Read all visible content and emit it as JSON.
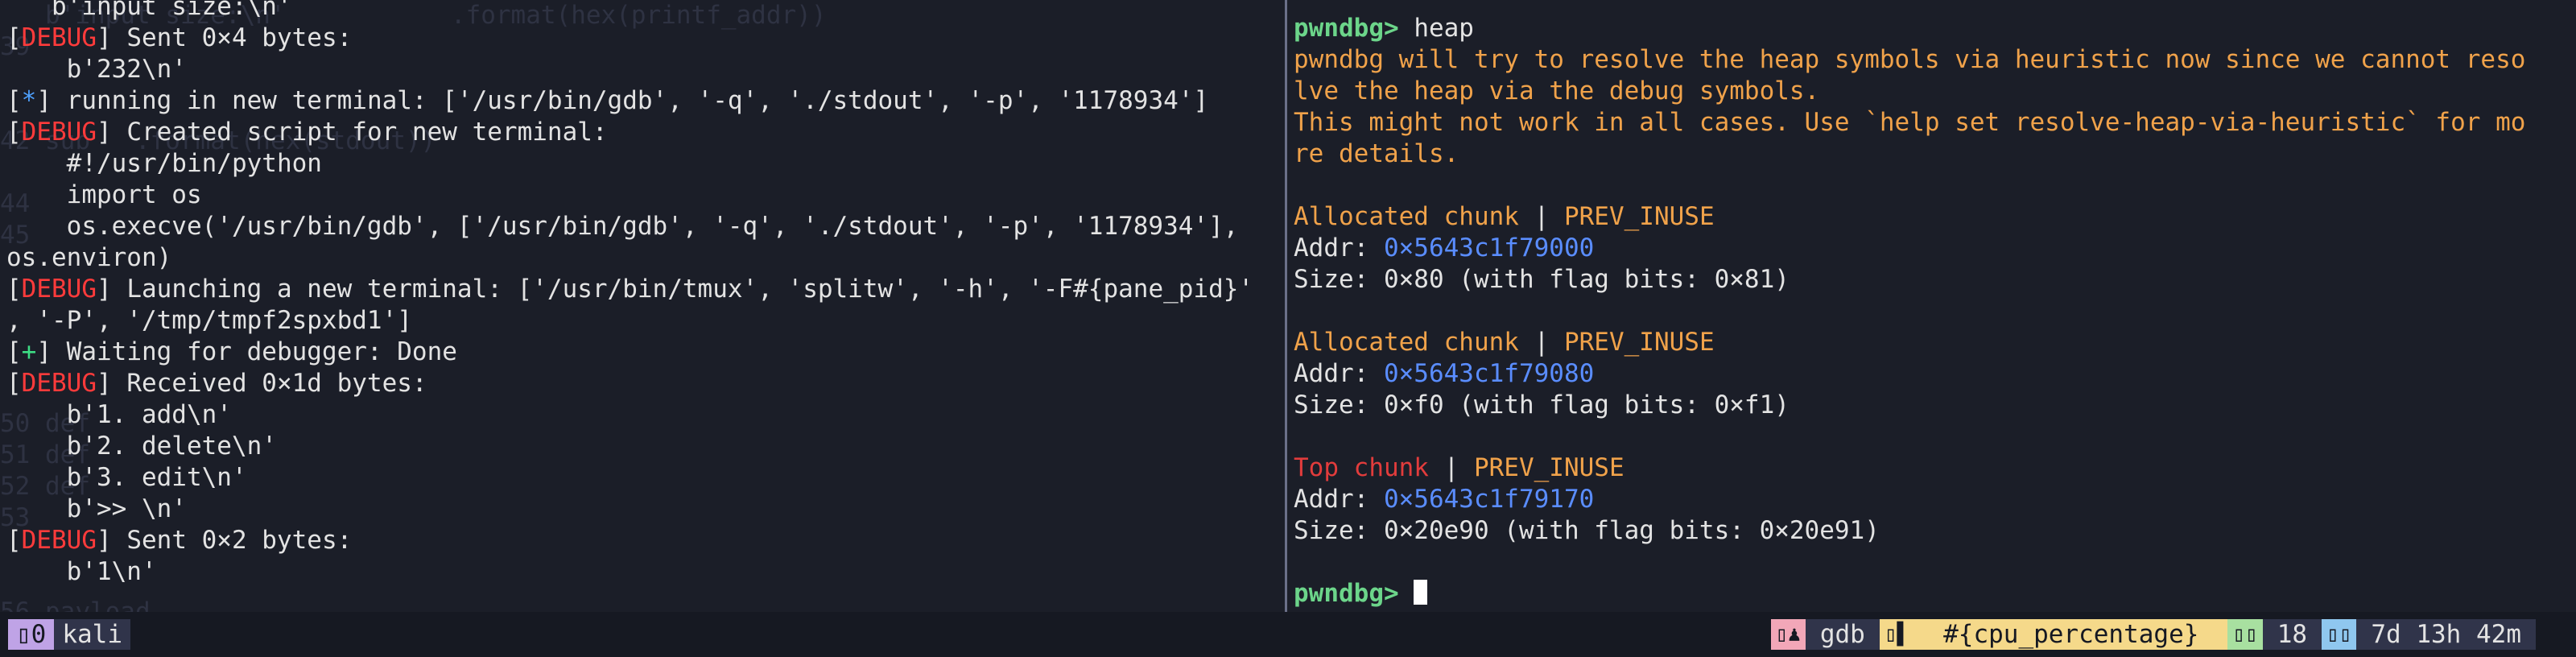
{
  "background_code": [
    "   b'input size:\\n'           .format(hex(printf_addr))",
    "39",
    "",
    "",
    "42 sub   .format(hex(stdout))",
    "",
    "44",
    "45",
    "",
    "",
    "",
    "",
    "",
    "50 def",
    "51 def",
    "52 def",
    "53",
    "",
    "",
    "56 payload"
  ],
  "left_pane": {
    "lines": [
      {
        "parts": [
          {
            "t": "   b'input size:\\n'",
            "c": "brk"
          }
        ]
      },
      {
        "parts": [
          {
            "t": "[",
            "c": "brk"
          },
          {
            "t": "DEBUG",
            "c": "dbg"
          },
          {
            "t": "] Sent 0×4 bytes:",
            "c": "brk"
          }
        ]
      },
      {
        "parts": [
          {
            "t": "    b'232\\n'",
            "c": "brk"
          }
        ]
      },
      {
        "parts": [
          {
            "t": "[",
            "c": "brk"
          },
          {
            "t": "*",
            "c": "star"
          },
          {
            "t": "] running in new terminal: ['/usr/bin/gdb', '-q', './stdout', '-p', '1178934']",
            "c": "brk"
          }
        ]
      },
      {
        "parts": [
          {
            "t": "[",
            "c": "brk"
          },
          {
            "t": "DEBUG",
            "c": "dbg"
          },
          {
            "t": "] Created script for new terminal:",
            "c": "brk"
          }
        ]
      },
      {
        "parts": [
          {
            "t": "    #!/usr/bin/python",
            "c": "brk"
          }
        ]
      },
      {
        "parts": [
          {
            "t": "    import os",
            "c": "brk"
          }
        ]
      },
      {
        "parts": [
          {
            "t": "    os.execve('/usr/bin/gdb', ['/usr/bin/gdb', '-q', './stdout', '-p', '1178934'],",
            "c": "brk"
          }
        ]
      },
      {
        "parts": [
          {
            "t": "os.environ)",
            "c": "brk"
          }
        ]
      },
      {
        "parts": [
          {
            "t": "[",
            "c": "brk"
          },
          {
            "t": "DEBUG",
            "c": "dbg"
          },
          {
            "t": "] Launching a new terminal: ['/usr/bin/tmux', 'splitw', '-h', '-F#{pane_pid}'",
            "c": "brk"
          }
        ]
      },
      {
        "parts": [
          {
            "t": ", '-P', '/tmp/tmpf2spxbd1']",
            "c": "brk"
          }
        ]
      },
      {
        "parts": [
          {
            "t": "[",
            "c": "brk"
          },
          {
            "t": "+",
            "c": "plus"
          },
          {
            "t": "] Waiting for debugger: Done",
            "c": "brk"
          }
        ]
      },
      {
        "parts": [
          {
            "t": "[",
            "c": "brk"
          },
          {
            "t": "DEBUG",
            "c": "dbg"
          },
          {
            "t": "] Received 0×1d bytes:",
            "c": "brk"
          }
        ]
      },
      {
        "parts": [
          {
            "t": "    b'1. add\\n'",
            "c": "brk"
          }
        ]
      },
      {
        "parts": [
          {
            "t": "    b'2. delete\\n'",
            "c": "brk"
          }
        ]
      },
      {
        "parts": [
          {
            "t": "    b'3. edit\\n'",
            "c": "brk"
          }
        ]
      },
      {
        "parts": [
          {
            "t": "    b'>> \\n'",
            "c": "brk"
          }
        ]
      },
      {
        "parts": [
          {
            "t": "[",
            "c": "brk"
          },
          {
            "t": "DEBUG",
            "c": "dbg"
          },
          {
            "t": "] Sent 0×2 bytes:",
            "c": "brk"
          }
        ]
      },
      {
        "parts": [
          {
            "t": "    b'1\\n'",
            "c": "brk"
          }
        ]
      }
    ]
  },
  "right_pane": {
    "lines": [
      {
        "parts": [
          {
            "t": "pwndbg>",
            "c": "prompt"
          },
          {
            "t": " heap",
            "c": "brk"
          }
        ]
      },
      {
        "parts": [
          {
            "t": "pwndbg will try to resolve the heap symbols via heuristic now since we cannot reso",
            "c": "warn"
          }
        ]
      },
      {
        "parts": [
          {
            "t": "lve the heap via the debug symbols.",
            "c": "warn"
          }
        ]
      },
      {
        "parts": [
          {
            "t": "This might not work in all cases. Use `help set resolve-heap-via-heuristic` for mo",
            "c": "warn"
          }
        ]
      },
      {
        "parts": [
          {
            "t": "re details.",
            "c": "warn"
          }
        ]
      },
      {
        "parts": [
          {
            "t": "",
            "c": "brk"
          }
        ]
      },
      {
        "parts": [
          {
            "t": "Allocated chunk",
            "c": "warn"
          },
          {
            "t": " | ",
            "c": "brk"
          },
          {
            "t": "PREV_INUSE",
            "c": "warn"
          }
        ]
      },
      {
        "parts": [
          {
            "t": "Addr: ",
            "c": "brk"
          },
          {
            "t": "0×5643c1f79000",
            "c": "addr"
          }
        ]
      },
      {
        "parts": [
          {
            "t": "Size: 0×80 (with flag bits: 0×81)",
            "c": "brk"
          }
        ]
      },
      {
        "parts": [
          {
            "t": "",
            "c": "brk"
          }
        ]
      },
      {
        "parts": [
          {
            "t": "Allocated chunk",
            "c": "warn"
          },
          {
            "t": " | ",
            "c": "brk"
          },
          {
            "t": "PREV_INUSE",
            "c": "warn"
          }
        ]
      },
      {
        "parts": [
          {
            "t": "Addr: ",
            "c": "brk"
          },
          {
            "t": "0×5643c1f79080",
            "c": "addr"
          }
        ]
      },
      {
        "parts": [
          {
            "t": "Size: 0×f0 (with flag bits: 0×f1)",
            "c": "brk"
          }
        ]
      },
      {
        "parts": [
          {
            "t": "",
            "c": "brk"
          }
        ]
      },
      {
        "parts": [
          {
            "t": "Top chunk",
            "c": "top"
          },
          {
            "t": " | ",
            "c": "brk"
          },
          {
            "t": "PREV_INUSE",
            "c": "warn"
          }
        ]
      },
      {
        "parts": [
          {
            "t": "Addr: ",
            "c": "brk"
          },
          {
            "t": "0×5643c1f79170",
            "c": "addr"
          }
        ]
      },
      {
        "parts": [
          {
            "t": "Size: 0×20e90 (with flag bits: 0×20e91)",
            "c": "brk"
          }
        ]
      },
      {
        "parts": [
          {
            "t": "",
            "c": "brk"
          }
        ]
      },
      {
        "parts": [
          {
            "t": "pwndbg>",
            "c": "prompt"
          },
          {
            "t": " ",
            "c": "brk"
          }
        ],
        "cursor": true
      }
    ]
  },
  "statusbar": {
    "session_index": "0",
    "session_name": "kali",
    "window_name": "gdb",
    "cpu_label": "#{cpu_percentage}",
    "count": "18",
    "uptime": "7d 13h 42m",
    "icons": {
      "session": "tmux-session-icon",
      "window": "person-icon",
      "cpu": "cpu-icon",
      "count": "counter-icon",
      "uptime": "clock-icon"
    }
  },
  "colors": {
    "background": "#1b1e28",
    "debug": "#ff3b3b",
    "prompt": "#6cd58a",
    "warning": "#f0a24a",
    "address": "#5a8dff",
    "top_chunk": "#e23c3c"
  }
}
